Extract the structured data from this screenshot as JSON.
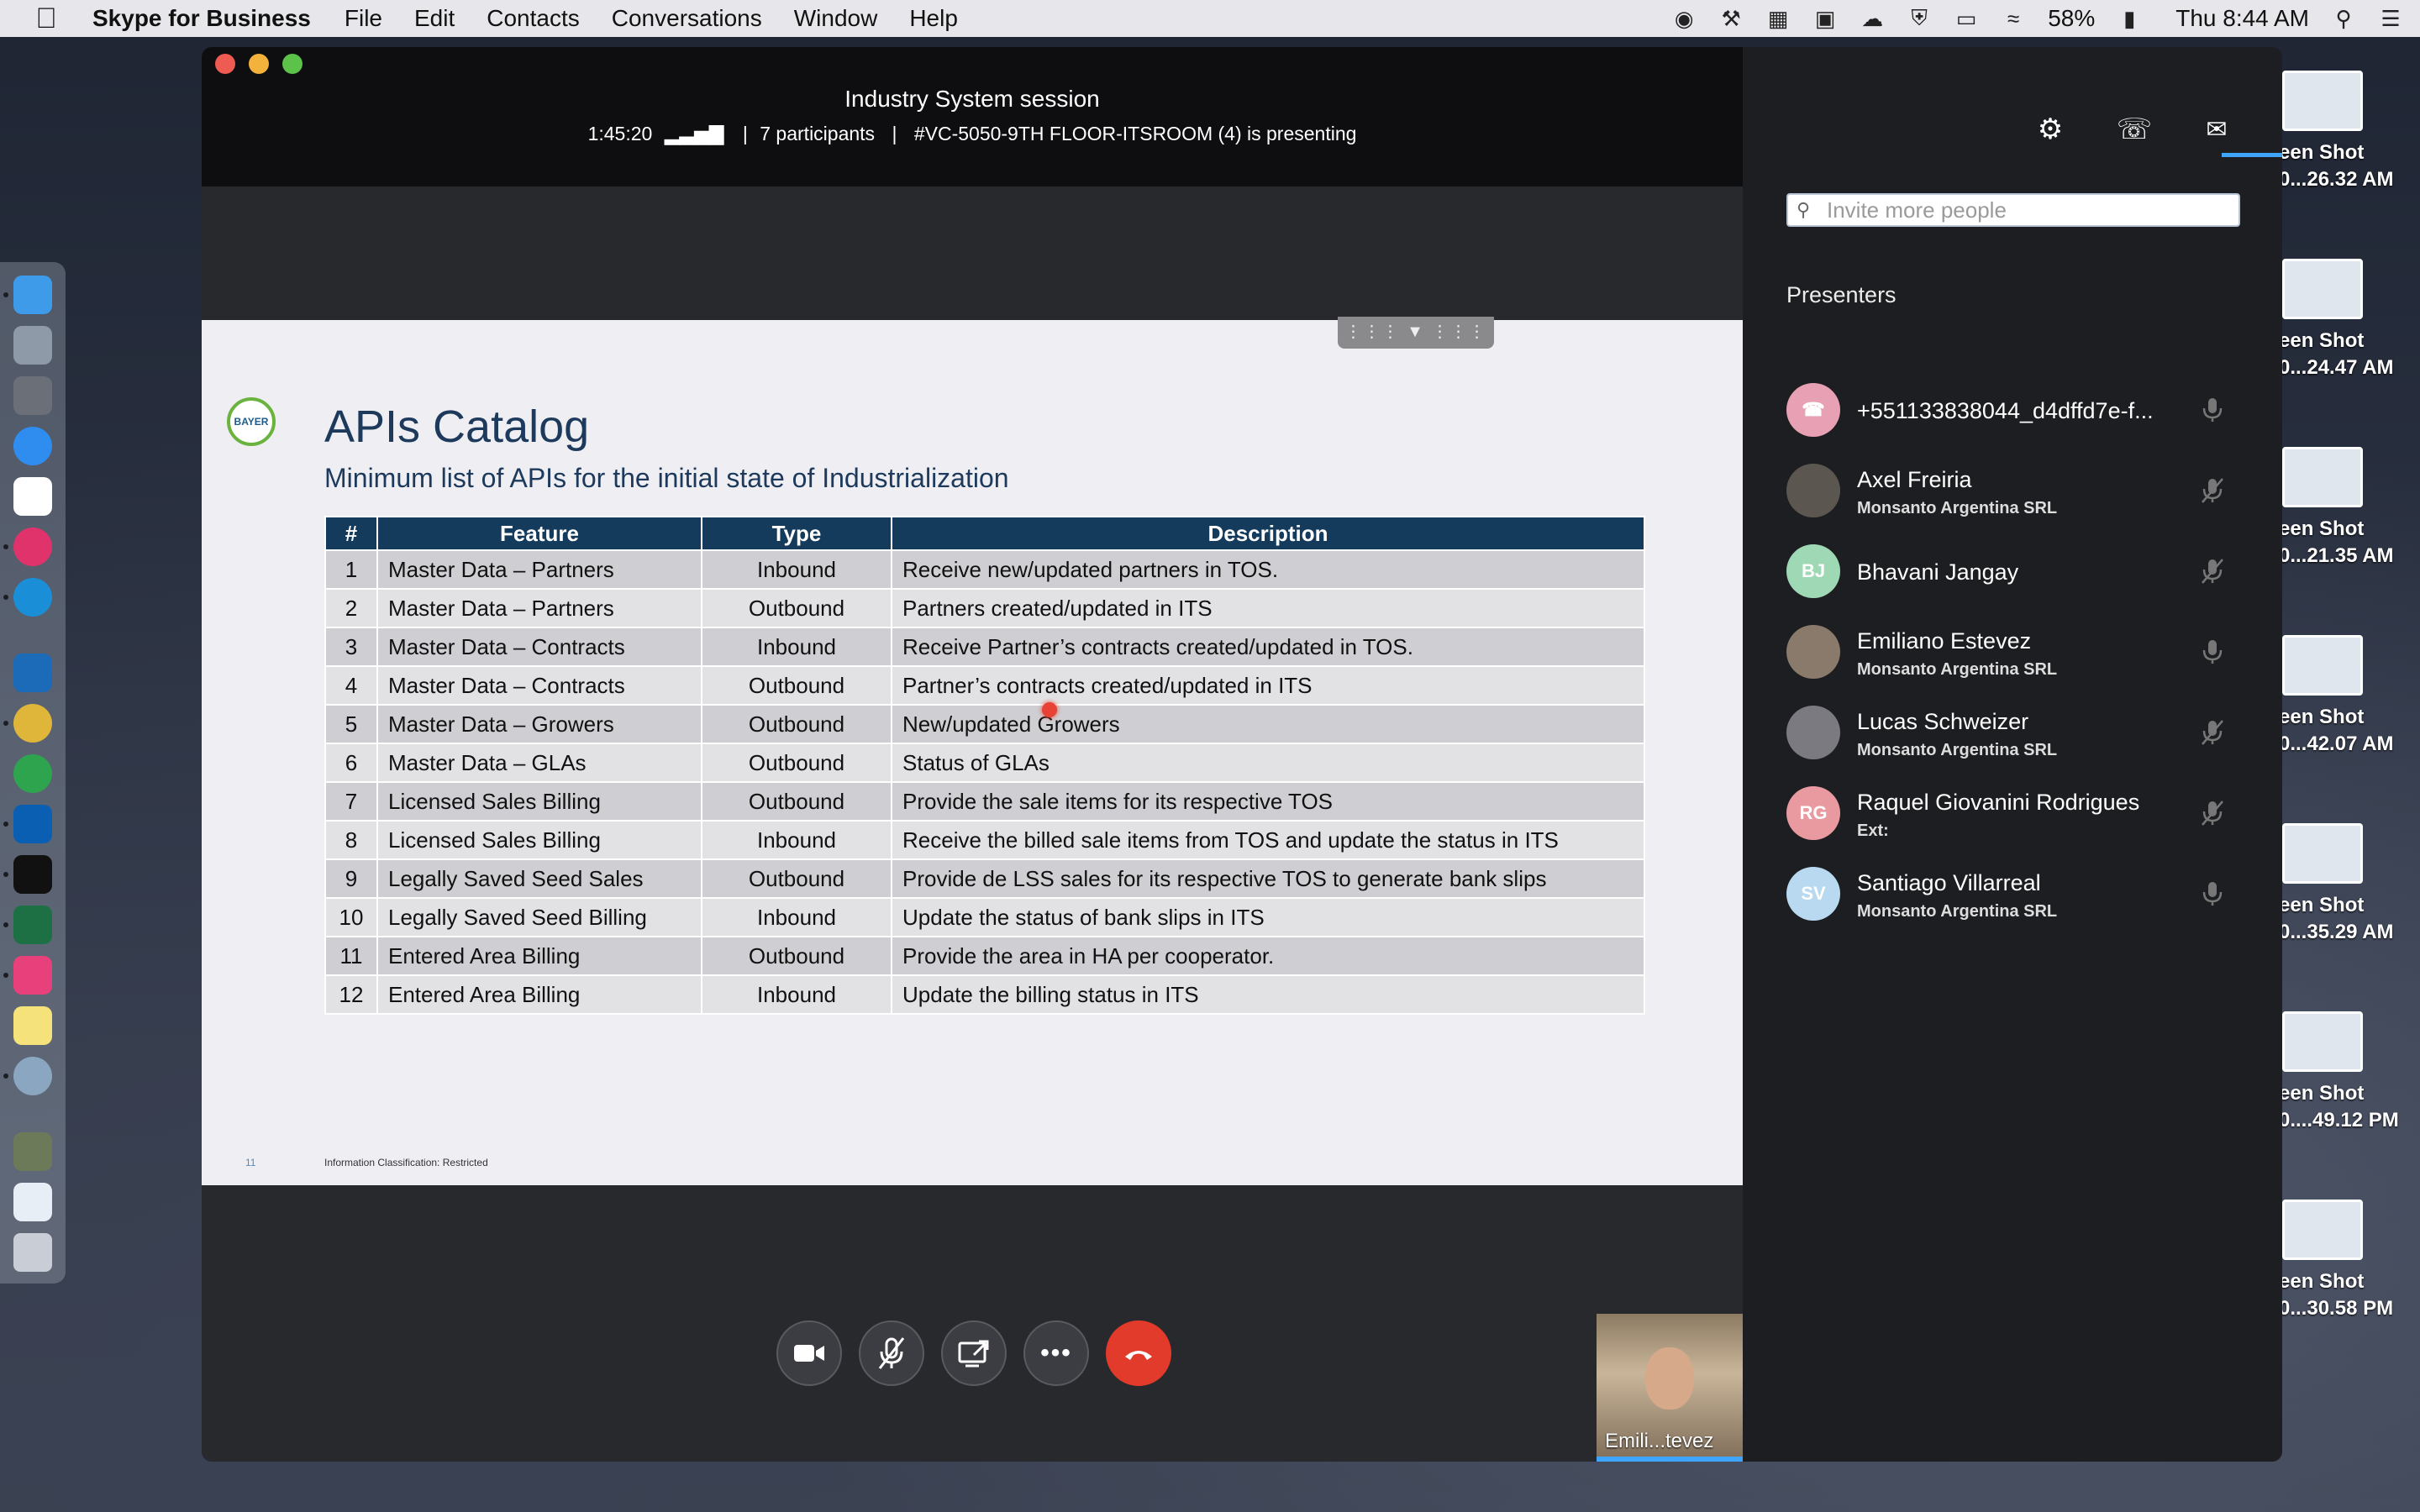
{
  "menubar": {
    "app_name": "Skype for Business",
    "menus": [
      "File",
      "Edit",
      "Contacts",
      "Conversations",
      "Window",
      "Help"
    ],
    "battery": "58%",
    "clock": "Thu 8:44 AM"
  },
  "desktop_files": [
    {
      "label1": "een Shot",
      "label2": "0...26.32 AM"
    },
    {
      "label1": "een Shot",
      "label2": "0...24.47 AM"
    },
    {
      "label1": "een Shot",
      "label2": "0...21.35 AM"
    },
    {
      "label1": "een Shot",
      "label2": "0...42.07 AM"
    },
    {
      "label1": "een Shot",
      "label2": "0...35.29 AM"
    },
    {
      "label1": "een Shot",
      "label2": "0....49.12 PM"
    },
    {
      "label1": "een Shot",
      "label2": "0...30.58 PM"
    }
  ],
  "session": {
    "title": "Industry System session",
    "duration": "1:45:20",
    "participants": "7 participants",
    "separator": "|",
    "presenting": "#VC-5050-9TH FLOOR-ITSROOM (4) is presenting"
  },
  "slide": {
    "logo_text": "BAYER",
    "title": "APIs Catalog",
    "subtitle": "Minimum list of APIs for the initial state of Industrialization",
    "table": {
      "headers": [
        "#",
        "Feature",
        "Type",
        "Description"
      ],
      "rows": [
        [
          "1",
          "Master Data – Partners",
          "Inbound",
          "Receive new/updated partners in TOS."
        ],
        [
          "2",
          "Master Data – Partners",
          "Outbound",
          "Partners created/updated in ITS"
        ],
        [
          "3",
          "Master Data – Contracts",
          "Inbound",
          "Receive Partner’s contracts created/updated in TOS."
        ],
        [
          "4",
          "Master Data – Contracts",
          "Outbound",
          "Partner’s contracts created/updated in ITS"
        ],
        [
          "5",
          "Master Data – Growers",
          "Outbound",
          "New/updated Growers"
        ],
        [
          "6",
          "Master Data – GLAs",
          "Outbound",
          "Status of GLAs"
        ],
        [
          "7",
          "Licensed Sales Billing",
          "Outbound",
          "Provide the sale items for its respective TOS"
        ],
        [
          "8",
          "Licensed Sales Billing",
          "Inbound",
          "Receive the billed sale items from TOS and update the status in ITS"
        ],
        [
          "9",
          "Legally Saved Seed Sales",
          "Outbound",
          "Provide de LSS sales for its respective TOS to generate bank slips"
        ],
        [
          "10",
          "Legally Saved Seed Billing",
          "Inbound",
          "Update the status of bank slips in ITS"
        ],
        [
          "11",
          "Entered Area Billing",
          "Outbound",
          "Provide the area in HA per cooperator."
        ],
        [
          "12",
          "Entered Area Billing",
          "Inbound",
          "Update the billing status in ITS"
        ]
      ]
    },
    "page_number": "11",
    "classification": "Information Classification: Restricted"
  },
  "self_view": {
    "name": "Emili...tevez"
  },
  "panel": {
    "invite_placeholder": "Invite more people",
    "section_title": "Presenters",
    "people": [
      {
        "name": "+551133838044_d4dffd7e-f...",
        "org": "",
        "initials": "",
        "avatar_color": "#e8a0b4",
        "muted": false
      },
      {
        "name": "Axel Freiria",
        "org": "Monsanto Argentina SRL",
        "initials": "",
        "avatar_color": "#5b5650",
        "muted": true
      },
      {
        "name": "Bhavani Jangay",
        "org": "",
        "initials": "BJ",
        "avatar_color": "#9fd8b5",
        "muted": true
      },
      {
        "name": "Emiliano Estevez",
        "org": "Monsanto Argentina SRL",
        "initials": "",
        "avatar_color": "#8a7a6b",
        "muted": false
      },
      {
        "name": "Lucas Schweizer",
        "org": "Monsanto Argentina SRL",
        "initials": "",
        "avatar_color": "#7a7a80",
        "muted": true
      },
      {
        "name": "Raquel Giovanini Rodrigues",
        "org": "Ext:",
        "initials": "RG",
        "avatar_color": "#e89aa0",
        "muted": true
      },
      {
        "name": "Santiago Villarreal",
        "org": "Monsanto Argentina SRL",
        "initials": "SV",
        "avatar_color": "#b8d9f0",
        "muted": false
      }
    ]
  }
}
